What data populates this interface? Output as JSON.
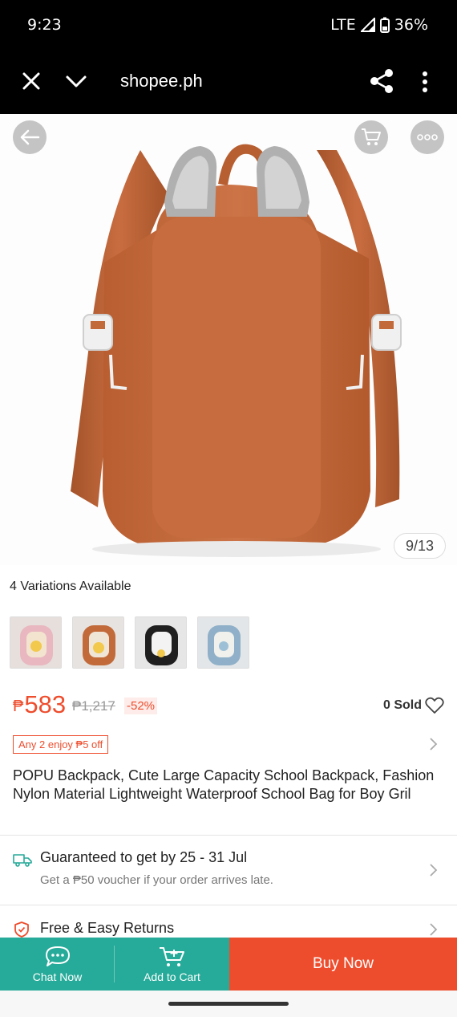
{
  "status_bar": {
    "time": "9:23",
    "network": "LTE",
    "battery": "36%"
  },
  "browser": {
    "url": "shopee.ph"
  },
  "gallery": {
    "counter": "9/13"
  },
  "variations": {
    "label": "4 Variations Available",
    "thumbnails": [
      {
        "name": "pink"
      },
      {
        "name": "brown"
      },
      {
        "name": "black"
      },
      {
        "name": "blue"
      }
    ]
  },
  "price": {
    "currency": "₱",
    "current": "583",
    "original": "₱1,217",
    "discount": "-52%",
    "sold": "0 Sold"
  },
  "voucher": {
    "label": "Any 2 enjoy ₱5 off"
  },
  "product": {
    "title": "POPU Backpack, Cute Large Capacity School Backpack, Fashion Nylon Material Lightweight Waterproof School Bag for Boy Gril"
  },
  "shipping": {
    "title": "Guaranteed to get by 25 - 31 Jul",
    "subtitle": "Get a ₱50 voucher if your order arrives late."
  },
  "returns": {
    "title": "Free & Easy Returns"
  },
  "actions": {
    "chat_label": "Chat Now",
    "cart_label": "Add to Cart",
    "buy_label": "Buy Now"
  },
  "colors": {
    "brand_orange": "#ee4d2d",
    "teal": "#26aa99",
    "backpack_brown": "#c26a3a"
  }
}
